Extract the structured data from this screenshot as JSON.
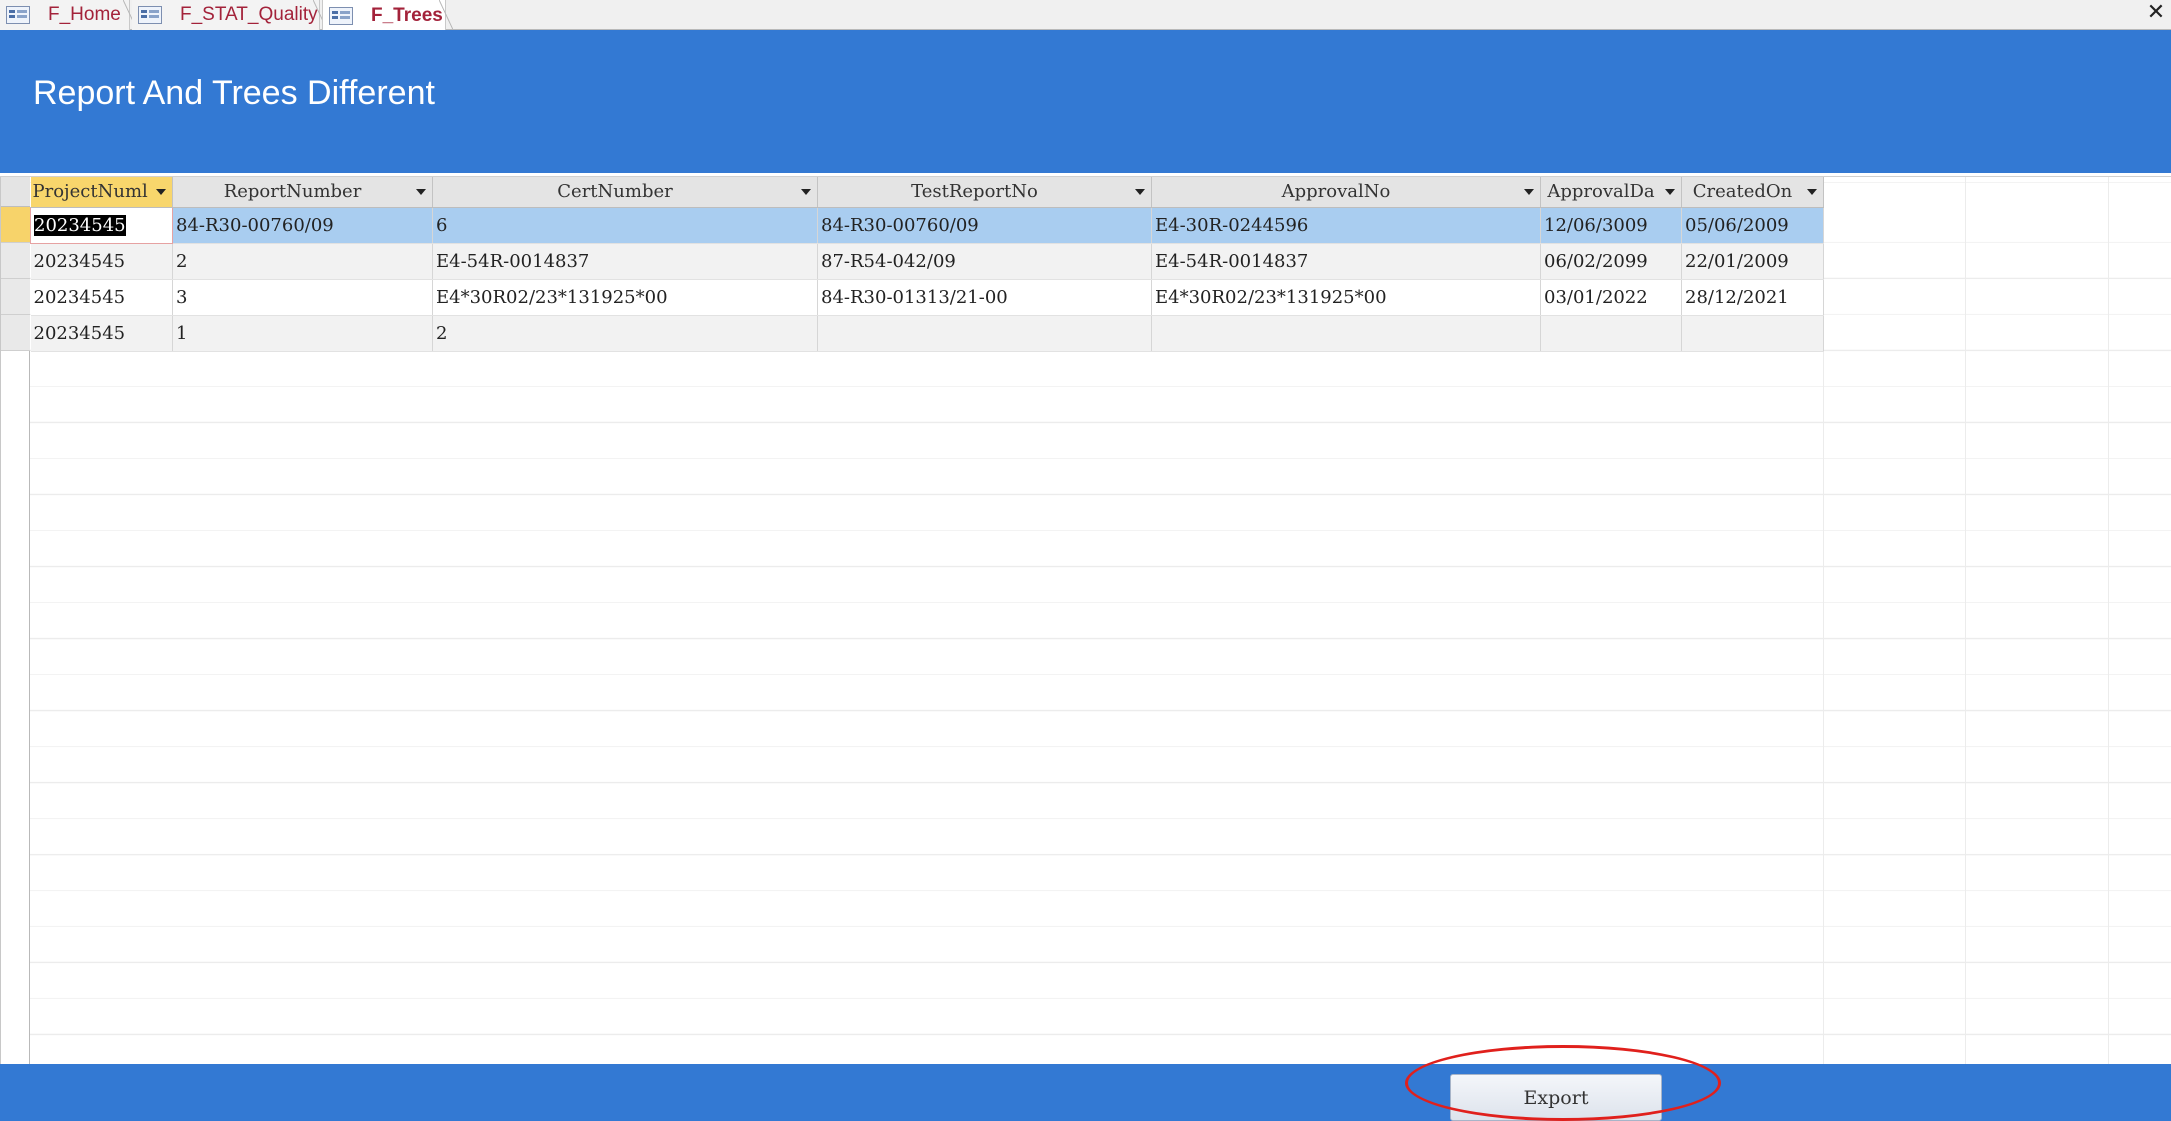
{
  "tabs": [
    {
      "label": "F_Home",
      "active": false
    },
    {
      "label": "F_STAT_Quality",
      "active": false
    },
    {
      "label": "F_Trees",
      "active": true
    }
  ],
  "window": {
    "close_glyph": "✕"
  },
  "header": {
    "title": "Report And Trees Different"
  },
  "table": {
    "columns": [
      "ProjectNuml",
      "ReportNumber",
      "CertNumber",
      "TestReportNo",
      "ApprovalNo",
      "ApprovalDa",
      "CreatedOn"
    ],
    "rows": [
      [
        "20234545",
        "84-R30-00760/09",
        "6",
        "84-R30-00760/09",
        "E4-30R-0244596",
        "12/06/3009",
        "05/06/2009"
      ],
      [
        "20234545",
        "2",
        "E4-54R-0014837",
        "87-R54-042/09",
        "E4-54R-0014837",
        "06/02/2099",
        "22/01/2009"
      ],
      [
        "20234545",
        "3",
        "E4*30R02/23*131925*00",
        "84-R30-01313/21-00",
        "E4*30R02/23*131925*00",
        "03/01/2022",
        "28/12/2021"
      ],
      [
        "20234545",
        "1",
        "2",
        "",
        "",
        "",
        ""
      ]
    ]
  },
  "footer": {
    "export_label": "Export"
  },
  "colors": {
    "header_band": "#3379d3",
    "tab_text": "#a3223a",
    "selected_row": "#a9cdf0",
    "annotation": "#e0201c"
  }
}
